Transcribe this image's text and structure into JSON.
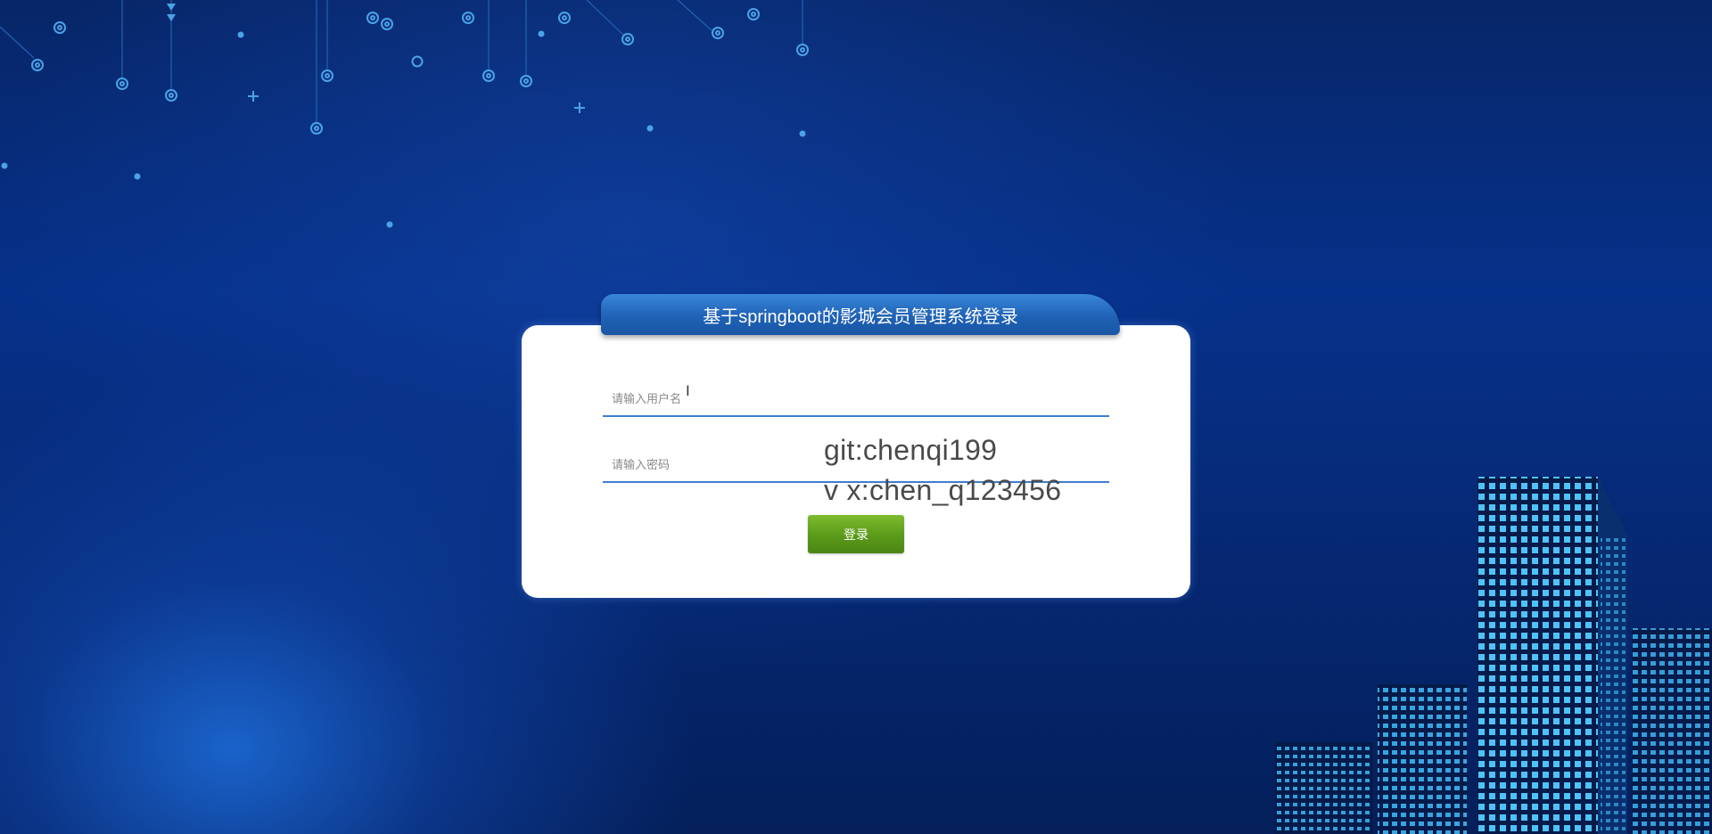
{
  "page": {
    "title": "基于springboot的影城会员管理系统登录"
  },
  "login_form": {
    "username_placeholder": "请输入用户名",
    "password_placeholder": "请输入密码",
    "login_button_label": "登录"
  },
  "watermark": {
    "line1": "git:chenqi199",
    "line2": "v x:chen_q123456"
  },
  "colors": {
    "title_bar": "#1f62b6",
    "login_button": "#5a9a1a",
    "field_underline": "#3c7fd0",
    "background": "#062a78",
    "building_lights": "#4fc3f7"
  },
  "icons": {
    "cursor": "text-cursor-icon"
  }
}
